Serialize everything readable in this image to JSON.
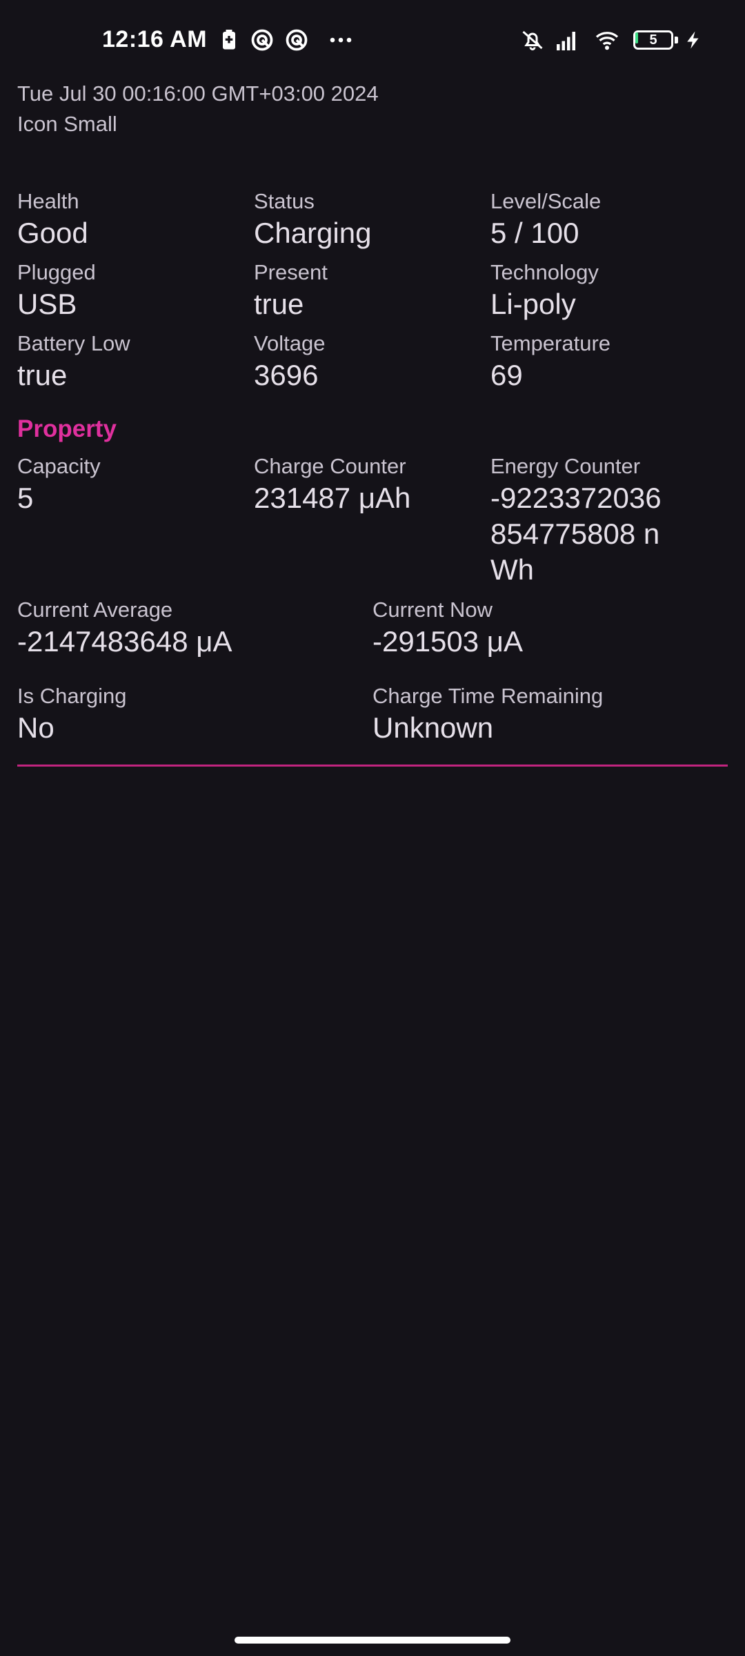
{
  "status_bar": {
    "time": "12:16 AM",
    "icons_left": [
      "battery-saver-icon",
      "notification-app-icon",
      "notification-app-icon",
      "more-dots-icon"
    ],
    "icons_right": [
      "silent-mode-icon",
      "signal-icon",
      "wifi-icon",
      "battery-icon",
      "charging-bolt-icon"
    ],
    "battery_level": "5",
    "battery_level_fraction": 0.05,
    "battery_fill_color": "#3ddc84"
  },
  "header": {
    "date": "Tue Jul 30 00:16:00 GMT+03:00 2024",
    "subtitle": "Icon Small"
  },
  "battery_info": {
    "health": {
      "label": "Health",
      "value": "Good"
    },
    "status": {
      "label": "Status",
      "value": "Charging"
    },
    "level_scale": {
      "label": "Level/Scale",
      "value": "5 / 100"
    },
    "plugged": {
      "label": "Plugged",
      "value": "USB"
    },
    "present": {
      "label": "Present",
      "value": "true"
    },
    "technology": {
      "label": "Technology",
      "value": "Li-poly"
    },
    "battery_low": {
      "label": "Battery Low",
      "value": "true"
    },
    "voltage": {
      "label": "Voltage",
      "value": "3696"
    },
    "temperature": {
      "label": "Temperature",
      "value": "69"
    }
  },
  "property": {
    "title": "Property",
    "capacity": {
      "label": "Capacity",
      "value": "5"
    },
    "charge_counter": {
      "label": "Charge Counter",
      "value": "231487 μAh"
    },
    "energy_counter": {
      "label": "Energy Counter",
      "value": "-9223372036854775808 nWh"
    },
    "current_average": {
      "label": "Current Average",
      "value": "-2147483648 μA"
    },
    "current_now": {
      "label": "Current Now",
      "value": "-291503 μA"
    },
    "is_charging": {
      "label": "Is Charging",
      "value": "No"
    },
    "charge_time_remaining": {
      "label": "Charge Time Remaining",
      "value": "Unknown"
    }
  },
  "colors": {
    "background": "#141218",
    "accent": "#e0309e",
    "divider": "#c2247f"
  }
}
